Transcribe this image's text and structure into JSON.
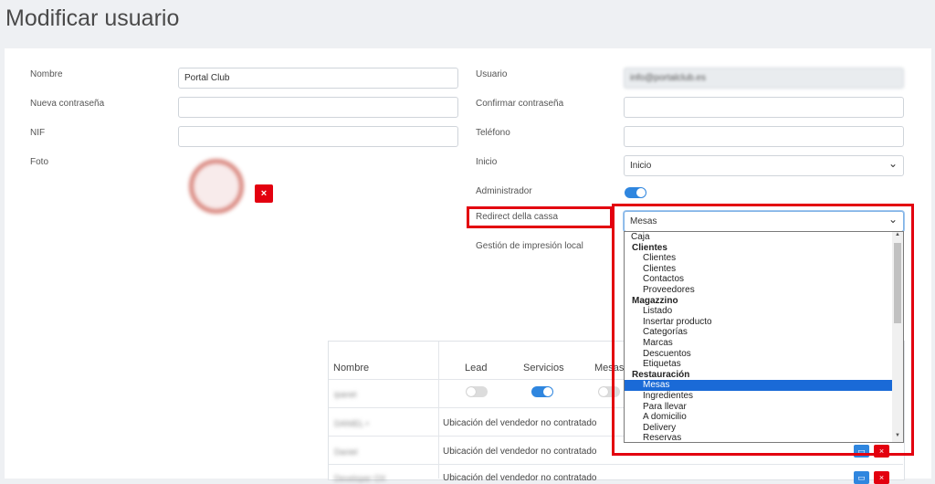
{
  "page": {
    "title": "Modificar usuario"
  },
  "form": {
    "left": {
      "nombre_label": "Nombre",
      "nombre_value": "Portal Club",
      "nueva_contrasena_label": "Nueva contraseña",
      "nif_label": "NIF",
      "foto_label": "Foto",
      "delete_icon": "×"
    },
    "right": {
      "usuario_label": "Usuario",
      "usuario_value": "info@portalclub.es",
      "confirmar_label": "Confirmar contraseña",
      "telefono_label": "Teléfono",
      "inicio_label": "Inicio",
      "inicio_value": "Inicio",
      "administrador_label": "Administrador",
      "administrador_on": true,
      "redirect_label": "Redirect della cassa",
      "redirect_value": "Mesas",
      "gestion_label": "Gestión de impresión local"
    }
  },
  "dropdown": {
    "options": [
      {
        "label": "Caja",
        "kind": "top"
      },
      {
        "label": "Clientes",
        "kind": "group"
      },
      {
        "label": "Clientes",
        "kind": "child"
      },
      {
        "label": "Clientes",
        "kind": "child"
      },
      {
        "label": "Contactos",
        "kind": "child"
      },
      {
        "label": "Proveedores",
        "kind": "child"
      },
      {
        "label": "Magazzino",
        "kind": "group"
      },
      {
        "label": "Listado",
        "kind": "child"
      },
      {
        "label": "Insertar producto",
        "kind": "child"
      },
      {
        "label": "Categorías",
        "kind": "child"
      },
      {
        "label": "Marcas",
        "kind": "child"
      },
      {
        "label": "Descuentos",
        "kind": "child"
      },
      {
        "label": "Etiquetas",
        "kind": "child"
      },
      {
        "label": "Restauración",
        "kind": "group"
      },
      {
        "label": "Mesas",
        "kind": "child",
        "selected": true
      },
      {
        "label": "Ingredientes",
        "kind": "child"
      },
      {
        "label": "Para llevar",
        "kind": "child"
      },
      {
        "label": "A domicilio",
        "kind": "child"
      },
      {
        "label": "Delivery",
        "kind": "child"
      },
      {
        "label": "Reservas",
        "kind": "child"
      }
    ]
  },
  "table": {
    "headers": {
      "nombre": "Nombre",
      "lead": "Lead",
      "servicios": "Servicios",
      "mesas": "Mesas"
    },
    "rows": [
      {
        "name": "ipanet",
        "lead_on": false,
        "servicios_on": true
      },
      {
        "name": "DANIEL •",
        "status": "Ubicación del vendedor no contratado"
      },
      {
        "name": "Daniel",
        "status": "Ubicación del vendedor no contratado"
      },
      {
        "name": "Developer OX",
        "status": "Ubicación del vendedor no contratado"
      }
    ]
  },
  "colors": {
    "accent": "#2f86df",
    "danger": "#e3000f",
    "selected": "#1a6ad7"
  }
}
